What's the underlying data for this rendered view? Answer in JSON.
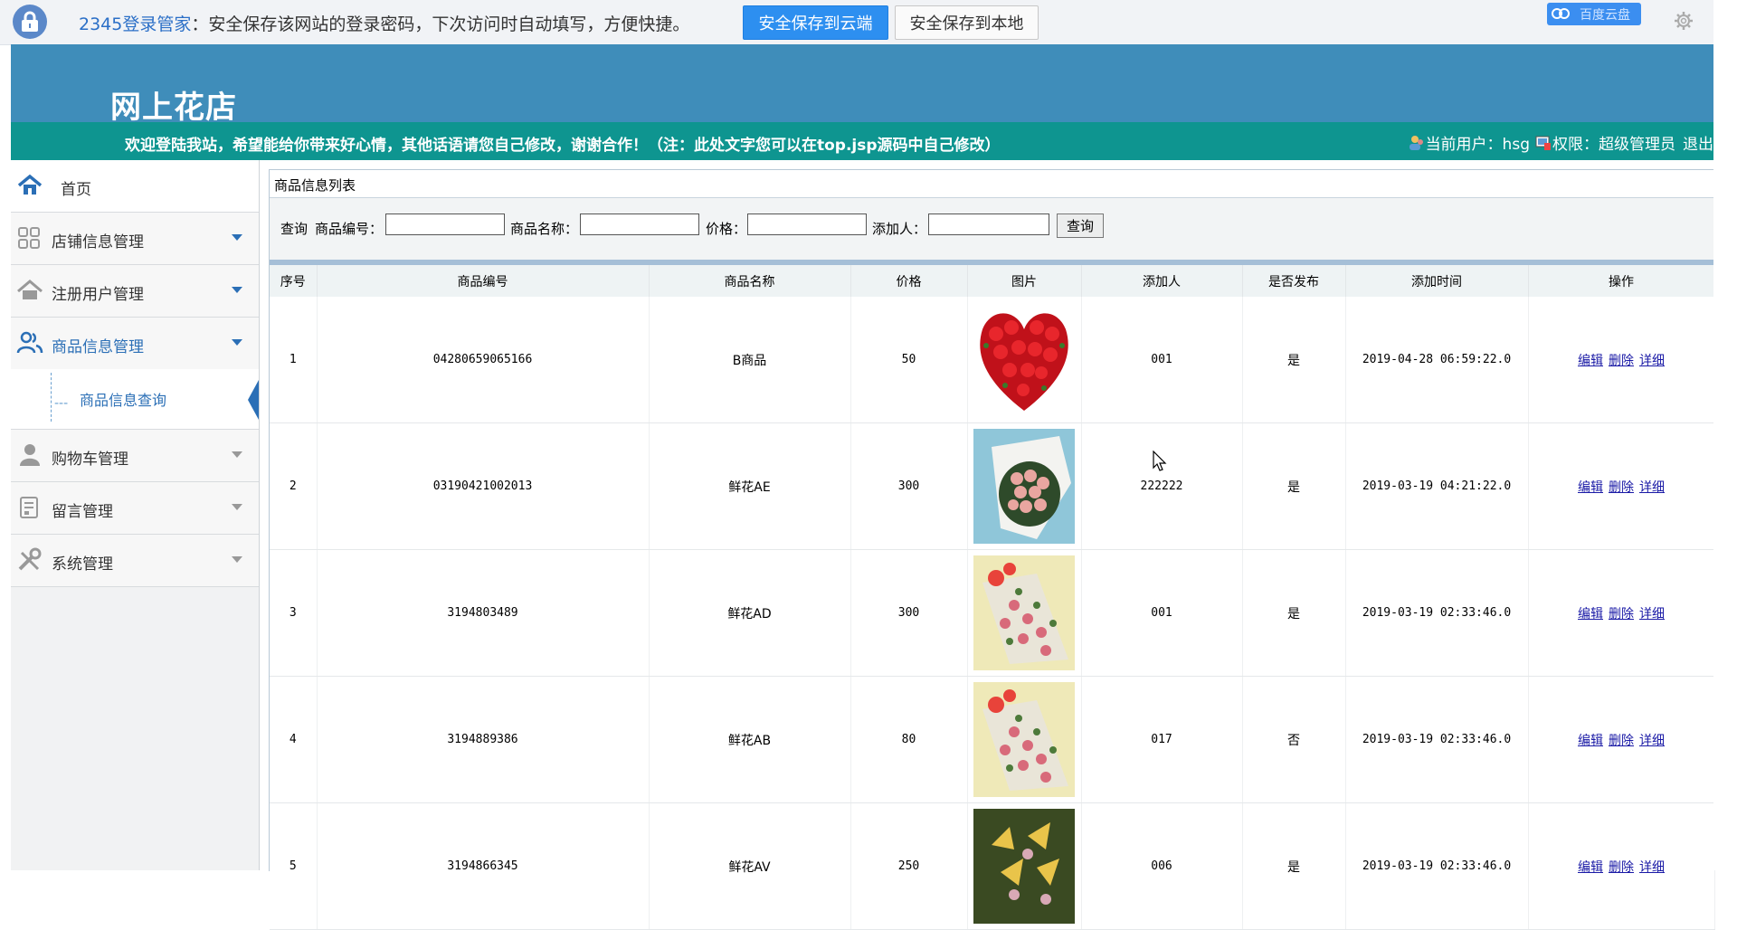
{
  "password_bar": {
    "brand": "2345登录管家",
    "message": "：安全保存该网站的登录密码，下次访问时自动填写，方便快捷。",
    "save_cloud_label": "安全保存到云端",
    "save_local_label": "安全保存到本地",
    "baidu_label": "百度云盘"
  },
  "site": {
    "title": "网上花店",
    "welcome": "欢迎登陆我站，希望能给你带来好心情，其他话语请您自己修改，谢谢合作！（注：此处文字您可以在top.jsp源码中自己修改）",
    "user_label": "当前用户：hsg",
    "role_label": "权限：超级管理员",
    "logout_label": "退出"
  },
  "sidebar": {
    "home": "首页",
    "items": [
      {
        "label": "店铺信息管理"
      },
      {
        "label": "注册用户管理"
      },
      {
        "label": "商品信息管理"
      },
      {
        "label": "购物车管理"
      },
      {
        "label": "留言管理"
      },
      {
        "label": "系统管理"
      }
    ],
    "sub_item": "商品信息查询"
  },
  "panel": {
    "title": "商品信息列表",
    "search": {
      "query_label": "查询",
      "code_label": "商品编号：",
      "name_label": "商品名称：",
      "price_label": "价格：",
      "adder_label": "添加人：",
      "button": "查询"
    }
  },
  "table": {
    "headers": [
      "序号",
      "商品编号",
      "商品名称",
      "价格",
      "图片",
      "添加人",
      "是否发布",
      "添加时间",
      "操作"
    ],
    "ops": {
      "edit": "编辑",
      "delete": "删除",
      "detail": "详细"
    },
    "rows": [
      {
        "no": "1",
        "code": "04280659065166",
        "name": "B商品",
        "price": "50",
        "image": "red-rose-heart",
        "adder": "001",
        "published": "是",
        "time": "2019-04-28 06:59:22.0"
      },
      {
        "no": "2",
        "code": "03190421002013",
        "name": "鲜花AE",
        "price": "300",
        "image": "pink-rose-bouquet",
        "adder": "222222",
        "published": "是",
        "time": "2019-03-19 04:21:22.0"
      },
      {
        "no": "3",
        "code": "3194803489",
        "name": "鲜花AD",
        "price": "300",
        "image": "mixed-bouquet-orange-ribbon",
        "adder": "001",
        "published": "是",
        "time": "2019-03-19 02:33:46.0"
      },
      {
        "no": "4",
        "code": "3194889386",
        "name": "鲜花AB",
        "price": "80",
        "image": "mixed-bouquet-orange-ribbon",
        "adder": "017",
        "published": "否",
        "time": "2019-03-19 02:33:46.0"
      },
      {
        "no": "5",
        "code": "3194866345",
        "name": "鲜花AV",
        "price": "250",
        "image": "yellow-lily-bouquet",
        "adder": "006",
        "published": "是",
        "time": "2019-03-19 02:33:46.0"
      }
    ]
  },
  "colors": {
    "header_blue": "#3f8dba",
    "welcome_teal": "#0e9590",
    "accent_blue": "#2b6fb6"
  }
}
